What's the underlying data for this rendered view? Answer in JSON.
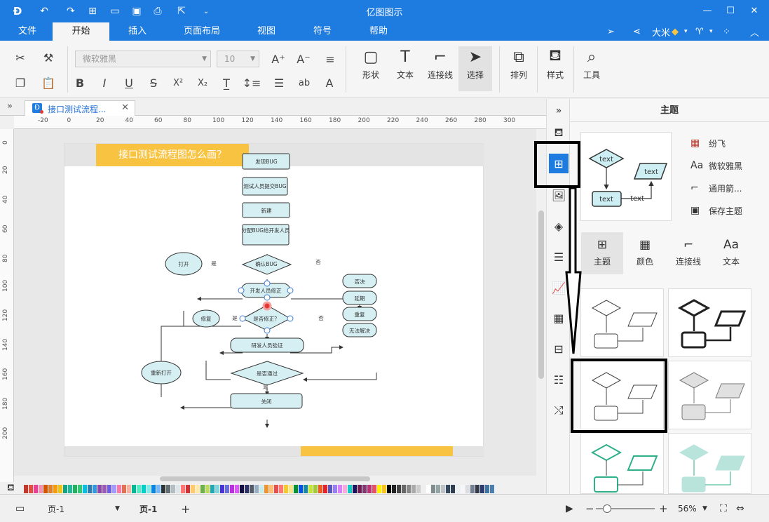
{
  "app": {
    "title": "亿图图示"
  },
  "menu": {
    "tabs": [
      "文件",
      "开始",
      "插入",
      "页面布局",
      "视图",
      "符号",
      "帮助"
    ],
    "active": "开始",
    "user": "大米"
  },
  "ribbon": {
    "font_name": "微软雅黑",
    "font_size": "10",
    "tools": {
      "shape": "形状",
      "text": "文本",
      "connector": "连接线",
      "select": "选择",
      "arrange": "排列",
      "style": "样式",
      "tool": "工具"
    }
  },
  "document": {
    "tab_name": "接口测试流程...",
    "page_title": "接口测试流程图怎么画？"
  },
  "ruler": {
    "h_ticks": [
      "-20",
      "0",
      "20",
      "40",
      "60",
      "80",
      "100",
      "120",
      "140",
      "160",
      "180",
      "200",
      "220",
      "240",
      "260",
      "280",
      "300"
    ],
    "v_ticks": [
      "0",
      "20",
      "40",
      "60",
      "80",
      "100",
      "120",
      "140",
      "160",
      "180",
      "200"
    ]
  },
  "flowchart": {
    "nodes": {
      "find_bug": "发现BUG",
      "tester_submit": "测试人员提交BUG",
      "new": "新建",
      "assign": "分配BUG给开发人员",
      "confirm": "确认BUG",
      "open": "打开",
      "dev_fix": "开发人员修正",
      "is_fixed": "是否修正？",
      "fix": "修复",
      "reject": "否决",
      "delay": "延期",
      "duplicate": "重复",
      "cannot_solve": "无法解决",
      "dev_verify": "研发人员验证",
      "is_passed": "是否通过",
      "reopen": "重新打开",
      "close": "关闭"
    },
    "labels": {
      "yes": "是",
      "no": "否"
    }
  },
  "panel": {
    "title": "主题",
    "preview_text": "text",
    "links": [
      "纷飞",
      "微软雅黑",
      "通用箭...",
      "保存主题"
    ],
    "tabs": [
      "主题",
      "颜色",
      "连接线",
      "文本"
    ],
    "active_tab": "主题"
  },
  "palette": {
    "colors": [
      "#c0392b",
      "#e74c3c",
      "#e84393",
      "#f78fb3",
      "#d35400",
      "#e67e22",
      "#f39c12",
      "#f1c40f",
      "#16a085",
      "#1abc9c",
      "#27ae60",
      "#2ecc71",
      "#0abde3",
      "#2980b9",
      "#3498db",
      "#8e44ad",
      "#9b59b6",
      "#6c5ce7",
      "#a29bfe",
      "#fd79a8",
      "#e17055",
      "#fab1a0",
      "#00b894",
      "#55efc4",
      "#00cec9",
      "#81ecec",
      "#0984e3",
      "#74b9ff",
      "#2d3436",
      "#636e72",
      "#b2bec3",
      "#dfe6e9",
      "#ff7675",
      "#d63031",
      "#fdcb6e",
      "#ffeaa7",
      "#6ab04c",
      "#badc58",
      "#22a6b3",
      "#7ed6df",
      "#4834d4",
      "#686de0",
      "#be2edd",
      "#e056fd",
      "#130f40",
      "#30336b",
      "#535c68",
      "#95afc0",
      "#c7ecee",
      "#f0932b",
      "#ffbe76",
      "#eb4d4b",
      "#ff7979",
      "#f9ca24",
      "#f6e58d",
      "#009432",
      "#0652dd",
      "#1289a7",
      "#c4e538",
      "#a3cb38",
      "#ee5a24",
      "#ea2027",
      "#5758bb",
      "#9980fa",
      "#d980fa",
      "#fda7df",
      "#12cbc4",
      "#1b1464",
      "#6f1e51",
      "#833471",
      "#b53471",
      "#ed4c67",
      "#fff200",
      "#ffc312",
      "#000000",
      "#222222",
      "#444444",
      "#666666",
      "#888888",
      "#aaaaaa",
      "#cccccc",
      "#eeeeee",
      "#ffffff",
      "#7f8c8d",
      "#95a5a6",
      "#bdc3c7",
      "#34495e",
      "#2c3e50",
      "#ecf0f1",
      "#f5f6fa",
      "#dcdde1",
      "#718093",
      "#353b48",
      "#273c75",
      "#40739e",
      "#487eb0"
    ]
  },
  "status": {
    "page_selector": "页-1",
    "page_tab": "页-1",
    "zoom": "56%"
  }
}
